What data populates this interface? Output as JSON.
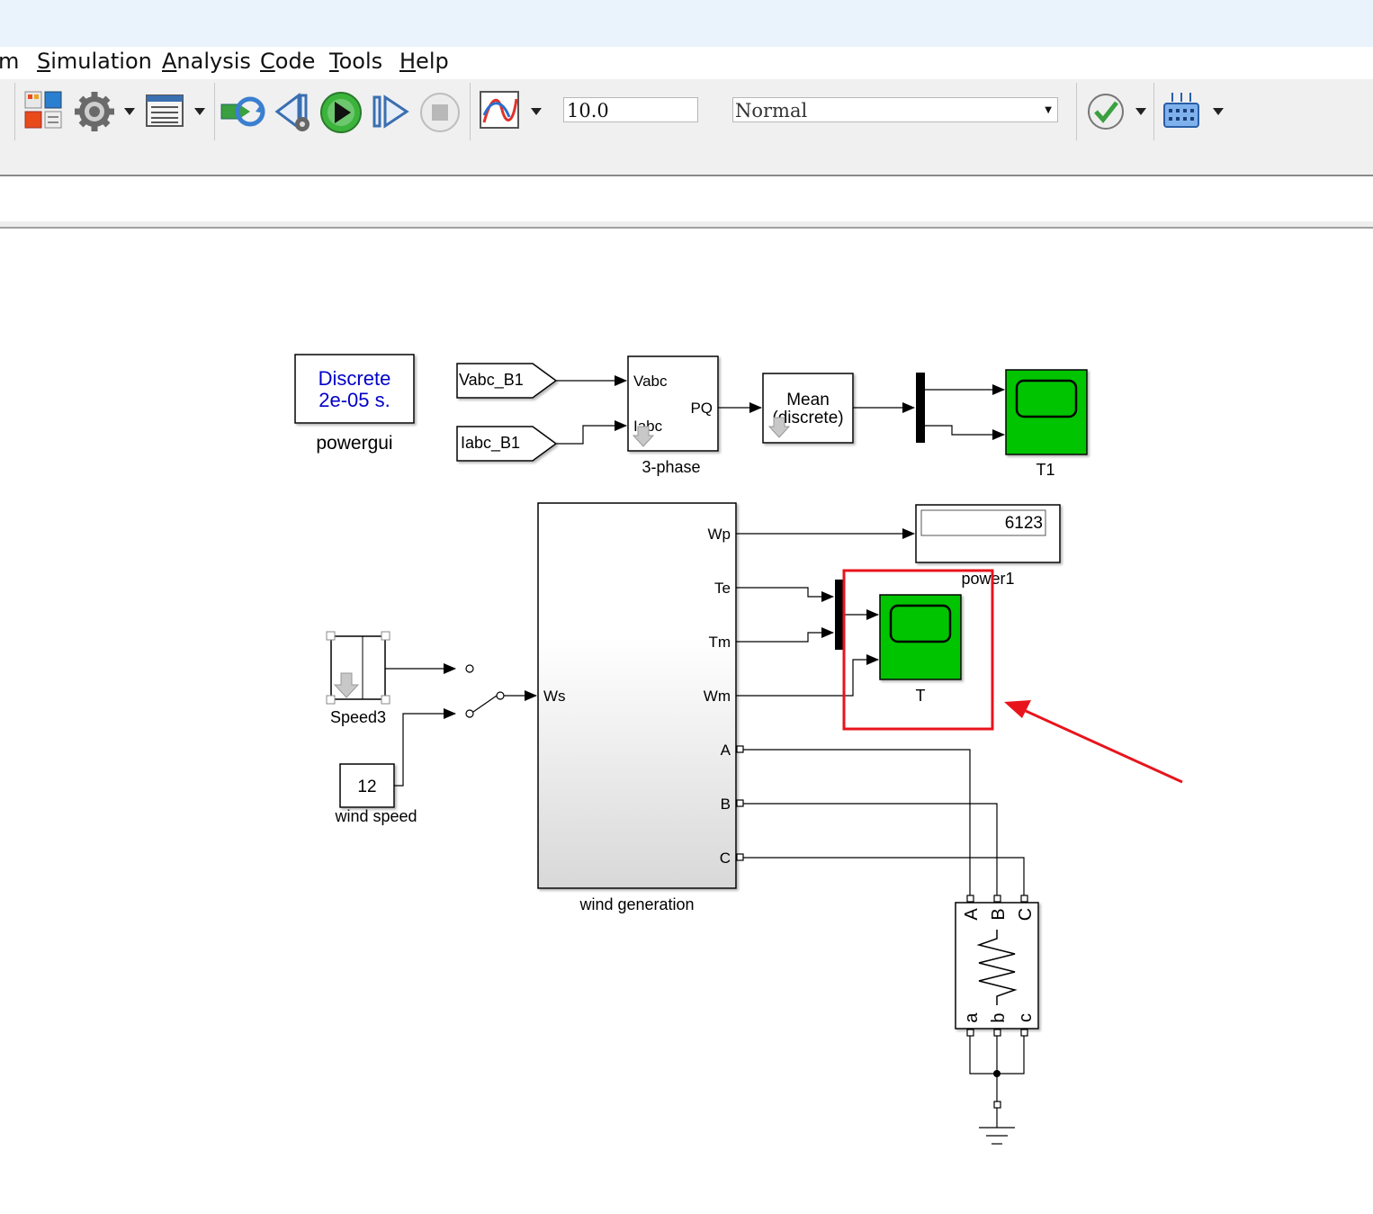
{
  "menu": {
    "partial": "m",
    "items": [
      {
        "key": "S",
        "rest": "imulation"
      },
      {
        "key": "A",
        "rest": "nalysis"
      },
      {
        "key": "C",
        "rest": "ode"
      },
      {
        "key": "T",
        "rest": "ools"
      },
      {
        "key": "H",
        "rest": "elp"
      }
    ]
  },
  "toolbar": {
    "stop_time": "10.0",
    "sim_mode": "Normal",
    "icons": [
      "library-browser-icon",
      "model-settings-gear-icon",
      "model-explorer-icon",
      "update-diagram-icon",
      "step-back-icon",
      "run-icon",
      "step-forward-icon",
      "stop-icon",
      "data-inspector-icon",
      "model-advisor-check-icon",
      "build-icon"
    ]
  },
  "diagram": {
    "powergui": {
      "line1": "Discrete",
      "line2": "2e-05 s.",
      "label": "powergui"
    },
    "from_vabc": "Vabc_B1",
    "from_iabc": "Iabc_B1",
    "pq_block": {
      "in1": "Vabc",
      "in2": "Iabc",
      "out": "PQ",
      "label": "3-phase"
    },
    "mean_block": {
      "line1": "Mean",
      "line2": "(discrete)"
    },
    "scope_t1": "T1",
    "wind_gen": {
      "label": "wind generation",
      "in": "Ws",
      "outs": [
        "Wp",
        "Te",
        "Tm",
        "Wm",
        "A",
        "B",
        "C"
      ]
    },
    "display": {
      "value": "6123",
      "label": "power1"
    },
    "scope_t": "T",
    "speed_block": "Speed3",
    "wind_speed": {
      "value": "12",
      "label": "wind speed"
    },
    "load": {
      "top": [
        "A",
        "B",
        "C"
      ],
      "bottom": [
        "a",
        "b",
        "c"
      ]
    }
  },
  "colors": {
    "scope_green": "#00c400",
    "highlight_red": "#e8141c",
    "signal_blue": "#0000c8"
  }
}
